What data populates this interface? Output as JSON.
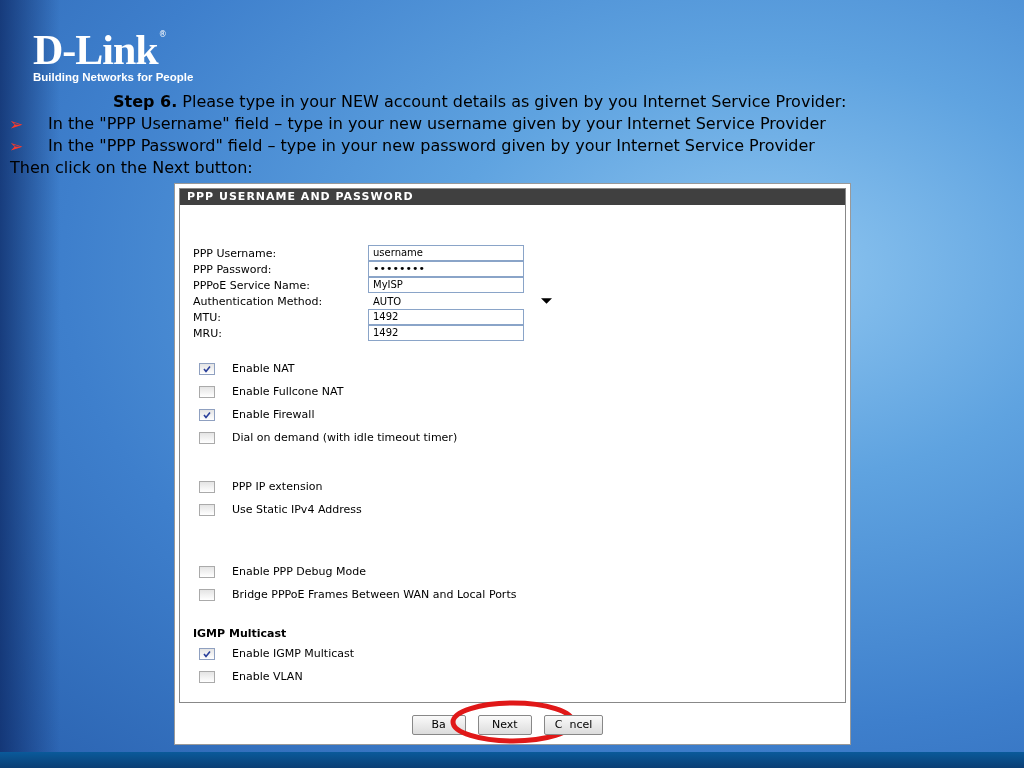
{
  "logo": {
    "name": "D-Link",
    "mark": "®",
    "tagline": "Building Networks for People"
  },
  "instructions": {
    "step": "**Step 6.** Please type in your NEW account details as given by you Internet Service Provider:",
    "bullets": [
      {
        "marker": "➢",
        "text": "In the \"PPP Username\" field – type in your new username given by your Internet Service Provider"
      },
      {
        "marker": "➢",
        "text": "In the \"PPP Password\" field – type in your new password given by your Internet Service Provider"
      }
    ],
    "closing": "Then click on the Next button:"
  },
  "panel": {
    "title": "PPP USERNAME AND PASSWORD",
    "fields": [
      {
        "label": "PPP Username:",
        "value": "username",
        "kind": "text"
      },
      {
        "label": "PPP Password:",
        "value": "••••••••",
        "kind": "password"
      },
      {
        "label": "PPPoE Service Name:",
        "value": "MyISP",
        "kind": "text"
      },
      {
        "label": "Authentication Method:",
        "value": "AUTO",
        "kind": "select"
      },
      {
        "label": "MTU:",
        "value": "1492",
        "kind": "text"
      },
      {
        "label": "MRU:",
        "value": "1492",
        "kind": "text"
      }
    ],
    "sections": [
      {
        "options": [
          {
            "label": "Enable NAT",
            "checked": true
          },
          {
            "label": "Enable Fullcone NAT",
            "checked": false
          },
          {
            "label": "Enable Firewall",
            "checked": true
          },
          {
            "label": "Dial on demand (with idle timeout timer)",
            "checked": false
          }
        ]
      },
      {
        "options": [
          {
            "label": "PPP IP extension",
            "checked": false
          },
          {
            "label": "Use Static IPv4 Address",
            "checked": false
          }
        ]
      },
      {
        "options": [
          {
            "label": "Enable PPP Debug Mode",
            "checked": false
          },
          {
            "label": "Bridge PPPoE Frames Between WAN and Local Ports",
            "checked": false
          }
        ]
      },
      {
        "heading": "IGMP Multicast",
        "options": [
          {
            "label": "Enable IGMP Multicast",
            "checked": true
          },
          {
            "label": "Enable VLAN",
            "checked": false
          }
        ]
      }
    ],
    "buttons": [
      {
        "parts": [
          "Ba"
        ],
        "circled": false
      },
      {
        "parts": [
          "Next"
        ],
        "circled": true
      },
      {
        "parts": [
          "C",
          "ncel"
        ],
        "circled": false
      }
    ]
  }
}
